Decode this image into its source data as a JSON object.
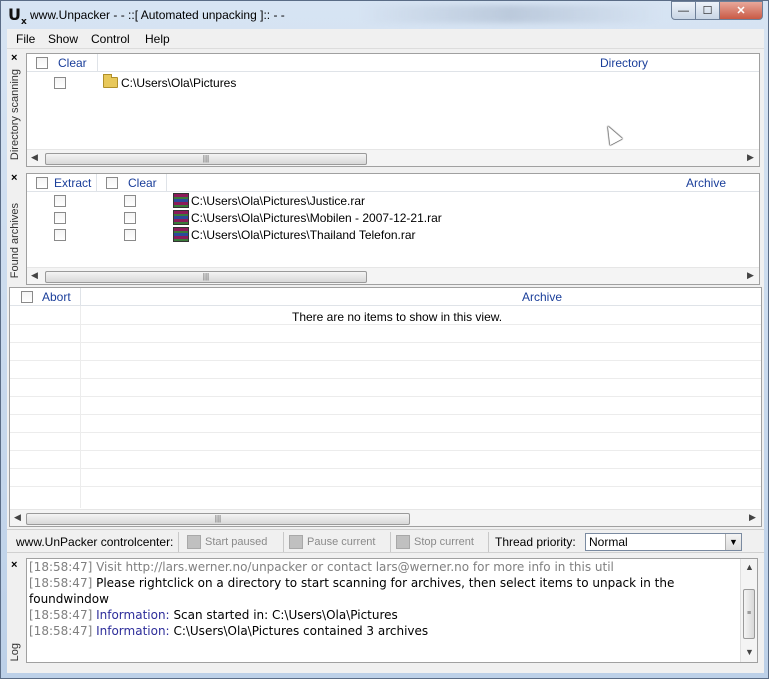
{
  "window": {
    "icon_text": "U",
    "icon_sub": "x",
    "title": "www.Unpacker - - ::[ Automated unpacking ]:: - -",
    "min_glyph": "—",
    "max_glyph": "☐",
    "close_glyph": "✕"
  },
  "menu": [
    "File",
    "Show",
    "Control",
    "Help"
  ],
  "directory_panel": {
    "side_label": "Directory scanning",
    "close_glyph": "×",
    "headers": {
      "clear": "Clear",
      "directory": "Directory"
    },
    "rows": [
      {
        "path": "C:\\Users\\Ola\\Pictures"
      }
    ]
  },
  "archives_panel": {
    "side_label": "Found archives",
    "close_glyph": "×",
    "headers": {
      "extract": "Extract",
      "clear": "Clear",
      "archive": "Archive"
    },
    "rows": [
      {
        "path": "C:\\Users\\Ola\\Pictures\\Justice.rar"
      },
      {
        "path": "C:\\Users\\Ola\\Pictures\\Mobilen - 2007-12-21.rar"
      },
      {
        "path": "C:\\Users\\Ola\\Pictures\\Thailand Telefon.rar"
      }
    ]
  },
  "unpack_panel": {
    "headers": {
      "abort": "Abort",
      "archive": "Archive"
    },
    "empty_text": "There are no items to show in this view."
  },
  "controlcenter": {
    "label": "www.UnPacker controlcenter:",
    "start_paused": "Start paused",
    "pause_current": "Pause current",
    "stop_current": "Stop current",
    "priority_label": "Thread priority:",
    "priority_value": "Normal"
  },
  "log": {
    "side_label": "Log",
    "close_glyph": "×",
    "lines": [
      {
        "ts": "[18:58:47]",
        "kind": "",
        "text": "Visit http://lars.werner.no/unpacker or contact lars@werner.no for more info in this util",
        "style": "gray"
      },
      {
        "ts": "[18:58:47]",
        "kind": "",
        "text": "Please rightclick on a directory to start scanning for archives, then select items to unpack in the foundwindow",
        "style": "normal"
      },
      {
        "ts": "[18:58:47]",
        "kind": "Information:",
        "text": "Scan started in: C:\\Users\\Ola\\Pictures",
        "style": "normal"
      },
      {
        "ts": "[18:58:47]",
        "kind": "Information:",
        "text": "C:\\Users\\Ola\\Pictures contained 3 archives",
        "style": "normal"
      }
    ]
  },
  "scroll_glyphs": {
    "left": "◀",
    "right": "▶",
    "up": "▲",
    "down": "▼",
    "grip": "|||",
    "grip_h": "≡"
  },
  "colors": {
    "header_text": "#1a3e9a",
    "info_text": "#2d2d9a",
    "timestamp": "#808080"
  }
}
